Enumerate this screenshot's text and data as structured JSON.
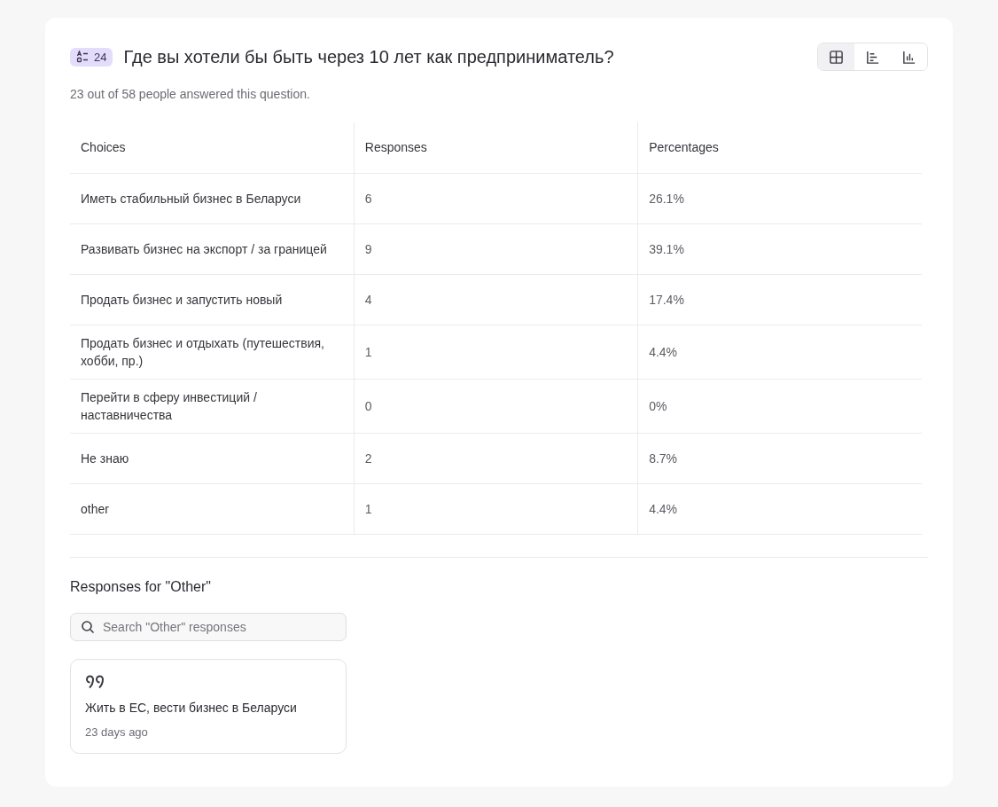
{
  "question": {
    "badge": "24",
    "title": "Где вы хотели бы быть через 10 лет как предприниматель?",
    "subtitle": "23 out of 58 people answered this question."
  },
  "view_modes": [
    {
      "kind": "table",
      "selected": true
    },
    {
      "kind": "horizontal-bars",
      "selected": false
    },
    {
      "kind": "vertical-bars",
      "selected": false
    }
  ],
  "table": {
    "columns": [
      "Choices",
      "Responses",
      "Percentages"
    ],
    "rows": [
      [
        "Иметь стабильный бизнес в Беларуси",
        "6",
        "26.1%"
      ],
      [
        "Развивать бизнес на экспорт / за границей",
        "9",
        "39.1%"
      ],
      [
        "Продать бизнес и запустить новый",
        "4",
        "17.4%"
      ],
      [
        "Продать бизнес и отдыхать (путешествия, хобби, пр.)",
        "1",
        "4.4%"
      ],
      [
        "Перейти в сферу инвестиций / наставничества",
        "0",
        "0%"
      ],
      [
        "Не знаю",
        "2",
        "8.7%"
      ],
      [
        "other",
        "1",
        "4.4%"
      ]
    ]
  },
  "other_responses": {
    "heading": "Responses for \"Other\"",
    "search": {
      "placeholder": "Search \"Other\" responses"
    },
    "items": [
      {
        "text": "Жить в ЕС, вести бизнес в Беларуси",
        "time": "23 days ago"
      }
    ]
  }
}
